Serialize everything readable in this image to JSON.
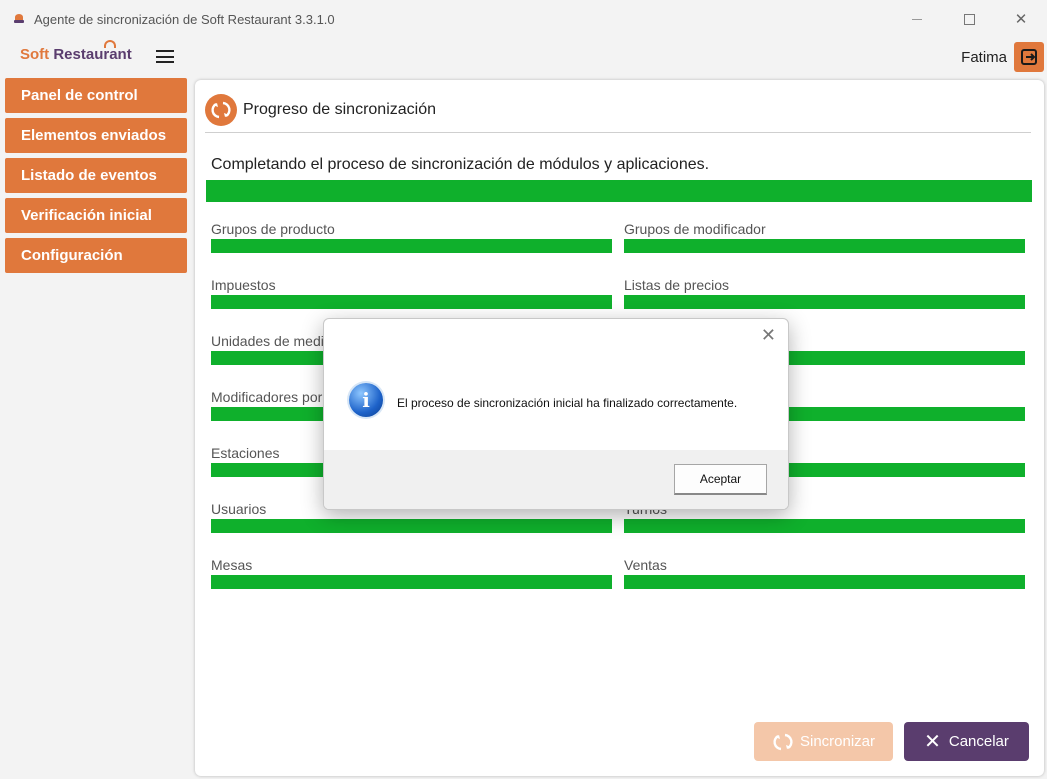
{
  "window": {
    "title": "Agente de sincronización de Soft Restaurant 3.3.1.0",
    "close_glyph": "✕"
  },
  "header": {
    "logo_soft": "Soft",
    "logo_restaurant": "Restaurant",
    "user_name": "Fatima"
  },
  "sidebar": {
    "items": [
      {
        "label": "Panel de control"
      },
      {
        "label": "Elementos enviados"
      },
      {
        "label": "Listado de eventos"
      },
      {
        "label": "Verificación inicial"
      },
      {
        "label": "Configuración"
      }
    ]
  },
  "panel": {
    "title": "Progreso de sincronización",
    "message": "Completando el proceso de sincronización de módulos y aplicaciones.",
    "main_progress": 1.0,
    "modules": [
      {
        "label": "Grupos de producto",
        "progress": 1.0
      },
      {
        "label": "Grupos de modificador",
        "progress": 1.0
      },
      {
        "label": "Impuestos",
        "progress": 1.0
      },
      {
        "label": "Listas de precios",
        "progress": 1.0
      },
      {
        "label": "Unidades de medi",
        "progress": 1.0
      },
      {
        "label": "",
        "progress": 1.0
      },
      {
        "label": "Modificadores por",
        "progress": 1.0
      },
      {
        "label": "",
        "progress": 1.0
      },
      {
        "label": "Estaciones",
        "progress": 1.0
      },
      {
        "label": "",
        "progress": 1.0
      },
      {
        "label": "Usuarios",
        "progress": 1.0
      },
      {
        "label": "Turnos",
        "progress": 1.0
      },
      {
        "label": "Mesas",
        "progress": 1.0
      },
      {
        "label": "Ventas",
        "progress": 1.0
      }
    ],
    "sync_button": "Sincronizar",
    "cancel_button": "Cancelar"
  },
  "dialog": {
    "message": "El proceso de sincronización inicial ha finalizado correctamente.",
    "ok_button": "Aceptar",
    "close_glyph": "✕",
    "icon_glyph": "i"
  },
  "colors": {
    "accent": "#e0783c",
    "brand_dark": "#5a3d6e",
    "progress": "#0fb02c"
  }
}
